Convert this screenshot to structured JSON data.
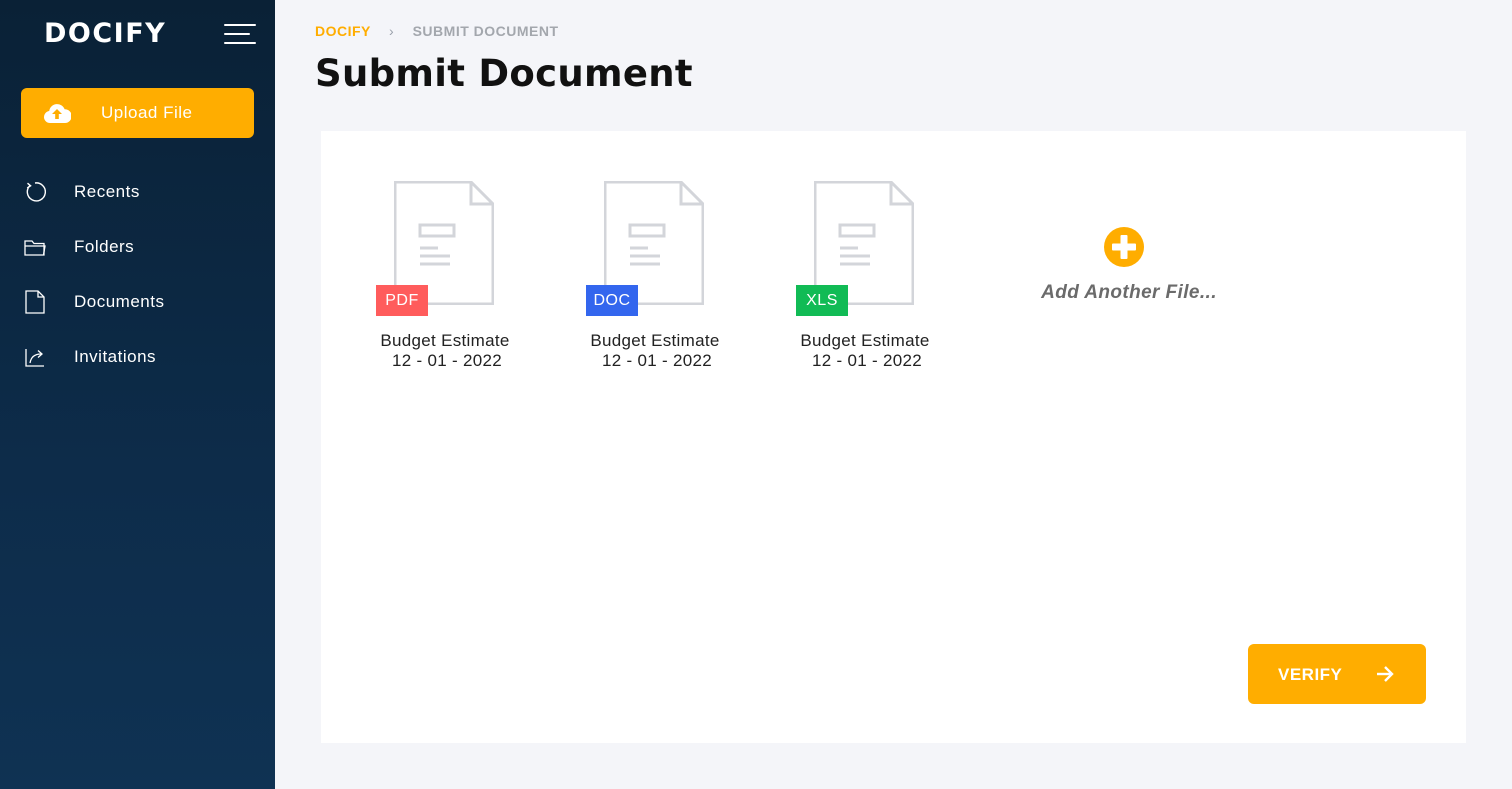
{
  "app": {
    "logo": "DOCIFY"
  },
  "sidebar": {
    "upload_label": "Upload File",
    "items": [
      {
        "label": "Recents",
        "icon": "refresh-icon"
      },
      {
        "label": "Folders",
        "icon": "folder-icon"
      },
      {
        "label": "Documents",
        "icon": "document-icon"
      },
      {
        "label": "Invitations",
        "icon": "share-icon"
      }
    ]
  },
  "breadcrumb": {
    "home": "DOCIFY",
    "current": "SUBMIT DOCUMENT"
  },
  "page": {
    "title": "Submit Document"
  },
  "files": [
    {
      "type": "PDF",
      "name": "Budget Estimate",
      "date": "12 - 01 - 2022",
      "color": "#ff5c5c"
    },
    {
      "type": "DOC",
      "name": "Budget Estimate",
      "date": "12 - 01 - 2022",
      "color": "#3366ee"
    },
    {
      "type": "XLS",
      "name": "Budget Estimate",
      "date": "12 - 01 - 2022",
      "color": "#11bb55"
    }
  ],
  "add_file_label": "Add Another File...",
  "verify_label": "VERIFY",
  "colors": {
    "accent": "#ffad00",
    "sidebar_bg": "#0d2c4a"
  }
}
